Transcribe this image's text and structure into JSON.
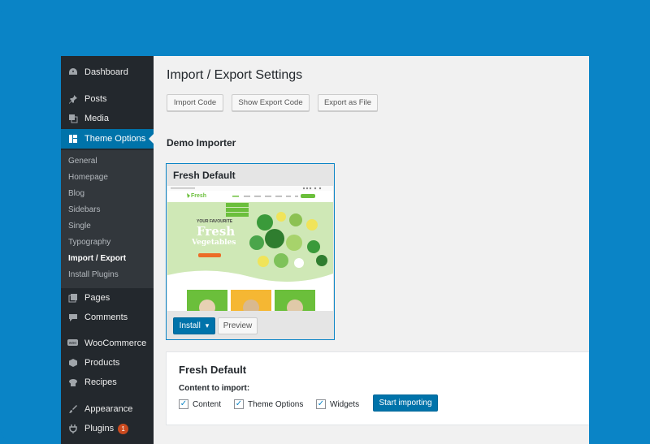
{
  "sidebar": {
    "menu": [
      {
        "label": "Dashboard",
        "icon": "dashboard-icon"
      },
      {
        "label": "Posts",
        "icon": "pin-icon"
      },
      {
        "label": "Media",
        "icon": "media-icon"
      },
      {
        "label": "Theme Options",
        "icon": "layout-icon"
      },
      {
        "label": "Pages",
        "icon": "pages-icon"
      },
      {
        "label": "Comments",
        "icon": "comments-icon"
      },
      {
        "label": "WooCommerce",
        "icon": "woo-icon"
      },
      {
        "label": "Products",
        "icon": "products-icon"
      },
      {
        "label": "Recipes",
        "icon": "recipes-icon"
      },
      {
        "label": "Appearance",
        "icon": "brush-icon"
      },
      {
        "label": "Plugins",
        "icon": "plugin-icon",
        "badge": "1"
      }
    ],
    "submenu": [
      "General",
      "Homepage",
      "Blog",
      "Sidebars",
      "Single",
      "Typography",
      "Import / Export",
      "Install Plugins"
    ]
  },
  "page": {
    "title": "Import / Export Settings",
    "buttons": {
      "import_code": "Import Code",
      "show_export": "Show Export Code",
      "export_file": "Export as File"
    },
    "demo_heading": "Demo Importer"
  },
  "demo_card": {
    "title": "Fresh Default",
    "install_label": "Install",
    "preview_label": "Preview",
    "thumb": {
      "brand": "Fresh",
      "tagline_small": "YOUR FAVOURITE",
      "headline_1": "Fresh",
      "headline_2": "Vegetables"
    }
  },
  "import_panel": {
    "title": "Fresh Default",
    "subtitle": "Content to import:",
    "options": [
      {
        "label": "Content",
        "checked": true
      },
      {
        "label": "Theme Options",
        "checked": true
      },
      {
        "label": "Widgets",
        "checked": true
      }
    ],
    "start_label": "Start importing"
  },
  "colors": {
    "accent": "#0073aa",
    "background": "#0a84c6",
    "sidebar": "#23282d",
    "badge": "#ca4a1f"
  }
}
